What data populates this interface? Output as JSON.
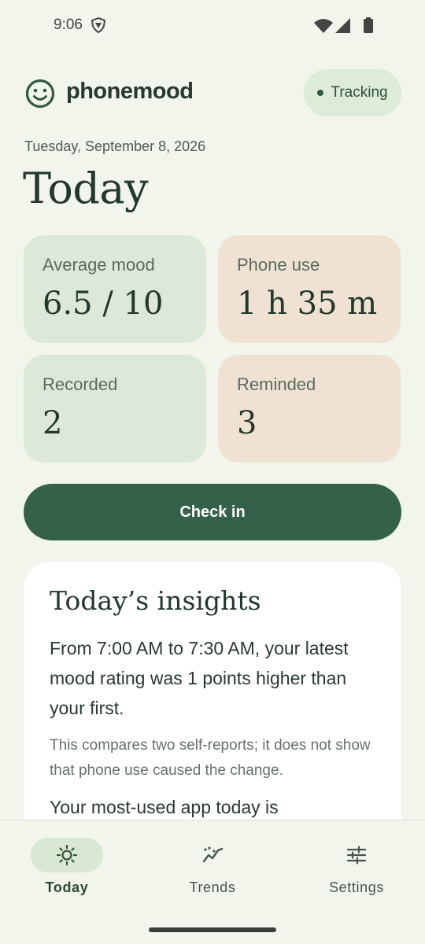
{
  "status_bar": {
    "time": "9:06",
    "icons": [
      "vpn-shield-icon",
      "wifi-icon",
      "signal-icon",
      "battery-icon"
    ]
  },
  "header": {
    "app_name": "phonemood",
    "logo_icon": "smiley-face-icon",
    "tracking_label": "Tracking"
  },
  "date": "Tuesday, September 8, 2026",
  "title": "Today",
  "stats": {
    "average_mood": {
      "label": "Average mood",
      "value": "6.5 / 10"
    },
    "phone_use": {
      "label": "Phone use",
      "value": "1 h 35 m"
    },
    "recorded": {
      "label": "Recorded",
      "value": "2"
    },
    "reminded": {
      "label": "Reminded",
      "value": "3"
    }
  },
  "checkin_label": "Check in",
  "insights": {
    "title": "Today’s insights",
    "body": "From 7:00 AM to 7:30 AM, your latest mood rating was 1 points higher than your first.",
    "note": "This compares two self-reports; it does not show that phone use caused the change.",
    "more": "Your most-used app today is"
  },
  "nav": {
    "today": {
      "label": "Today",
      "icon": "sun-icon",
      "active": true
    },
    "trends": {
      "label": "Trends",
      "icon": "trends-icon",
      "active": false
    },
    "settings": {
      "label": "Settings",
      "icon": "sliders-icon",
      "active": false
    }
  },
  "colors": {
    "background": "#f1f5ec",
    "primary": "#35604a",
    "card_green": "#dde9d8",
    "card_peach": "#f0e2d3"
  }
}
